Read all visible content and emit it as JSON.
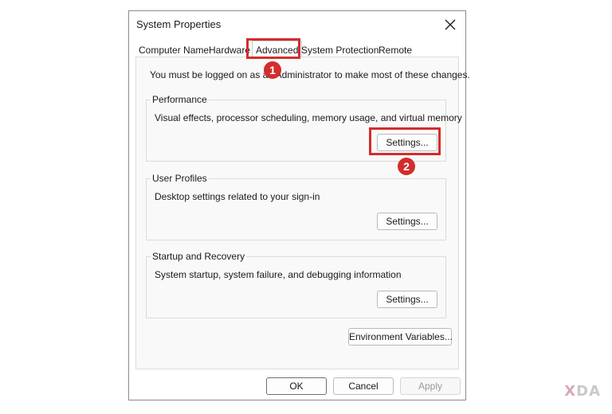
{
  "window": {
    "title": "System Properties",
    "close_glyph": "×"
  },
  "tabs": [
    {
      "label": "Computer Name",
      "active": false
    },
    {
      "label": "Hardware",
      "active": false
    },
    {
      "label": "Advanced",
      "active": true
    },
    {
      "label": "System Protection",
      "active": false
    },
    {
      "label": "Remote",
      "active": false
    }
  ],
  "advanced": {
    "info_text": "You must be logged on as an Administrator to make most of these changes.",
    "performance": {
      "title": "Performance",
      "description": "Visual effects, processor scheduling, memory usage, and virtual memory",
      "button": "Settings..."
    },
    "user_profiles": {
      "title": "User Profiles",
      "description": "Desktop settings related to your sign-in",
      "button": "Settings..."
    },
    "startup_recovery": {
      "title": "Startup and Recovery",
      "description": "System startup, system failure, and debugging information",
      "button": "Settings..."
    },
    "env_button": "Environment Variables..."
  },
  "footer": {
    "ok": "OK",
    "cancel": "Cancel",
    "apply": "Apply"
  },
  "annotations": {
    "step1": "1",
    "step2": "2",
    "color": "#d32d2d"
  },
  "watermark": {
    "brand_prefix": "X",
    "brand_rest": "DA"
  }
}
